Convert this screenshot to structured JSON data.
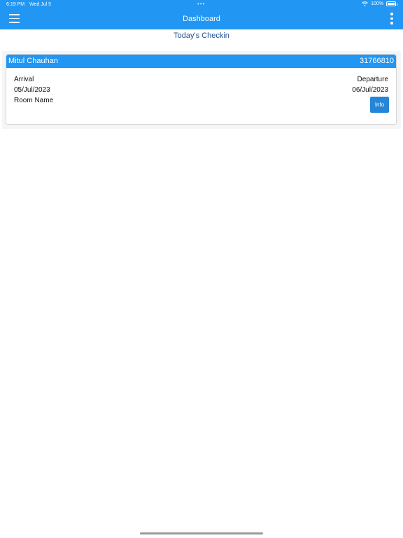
{
  "status_bar": {
    "time": "6:19 PM",
    "date": "Wed Jul 5",
    "dots": "•••",
    "battery_text": "100%"
  },
  "navbar": {
    "title": "Dashboard",
    "menu_icon": "hamburger-icon",
    "more_icon": "more-vertical-icon"
  },
  "page": {
    "subtitle": "Today's Checkin"
  },
  "checkin_card": {
    "guest_name": "Mitul Chauhan",
    "reservation_number": "31766810",
    "arrival_label": "Arrival",
    "arrival_date": "05/Jul/2023",
    "departure_label": "Departure",
    "departure_date": "06/Jul/2023",
    "room_name_label": "Room Name",
    "info_button_label": "Info"
  },
  "colors": {
    "primary": "#2196f3",
    "subtitle": "#1f4f8f",
    "info_button": "#2586d8"
  }
}
